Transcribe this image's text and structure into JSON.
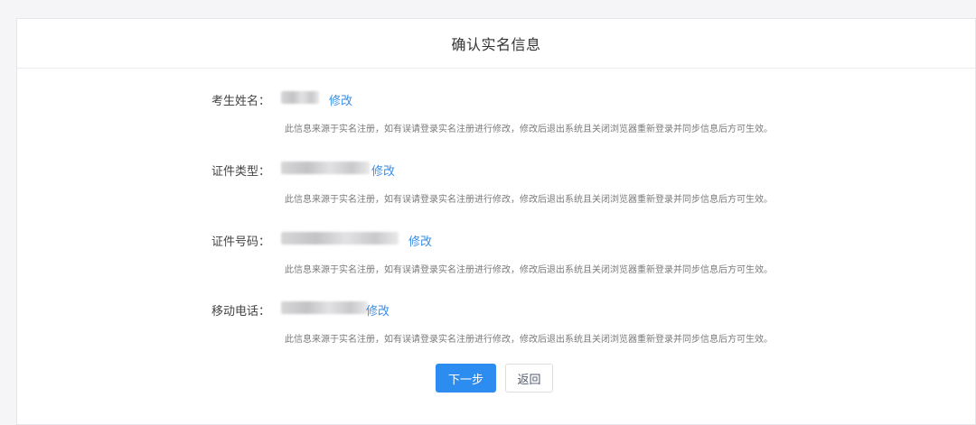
{
  "header": {
    "title": "确认实名信息"
  },
  "fields": [
    {
      "label": "考生姓名：",
      "edit_label": "修改",
      "note": "此信息来源于实名注册，如有误请登录实名注册进行修改，修改后退出系统且关闭浏览器重新登录并同步信息后方可生效。"
    },
    {
      "label": "证件类型：",
      "edit_label": "修改",
      "note": "此信息来源于实名注册，如有误请登录实名注册进行修改，修改后退出系统且关闭浏览器重新登录并同步信息后方可生效。"
    },
    {
      "label": "证件号码：",
      "edit_label": "修改",
      "note": "此信息来源于实名注册，如有误请登录实名注册进行修改，修改后退出系统且关闭浏览器重新登录并同步信息后方可生效。"
    },
    {
      "label": "移动电话：",
      "edit_label": "修改",
      "note": "此信息来源于实名注册，如有误请登录实名注册进行修改，修改后退出系统且关闭浏览器重新登录并同步信息后方可生效。"
    }
  ],
  "actions": {
    "next_label": "下一步",
    "back_label": "返回"
  },
  "colors": {
    "primary": "#2d8cf0",
    "link": "#3a8ee6",
    "note_text": "#7a7a7a",
    "label_text": "#444444"
  }
}
